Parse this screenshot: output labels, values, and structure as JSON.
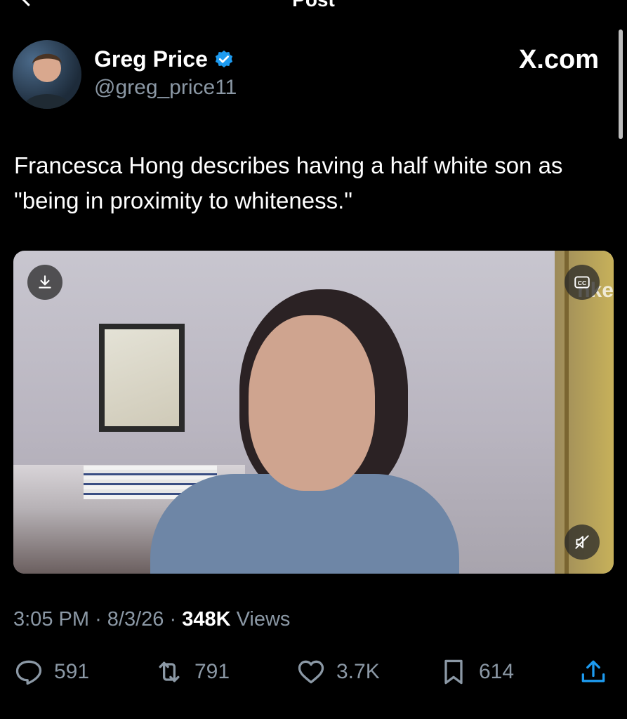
{
  "nav": {
    "title": "Post",
    "back_icon": "back-arrow-icon",
    "more_icon": "ellipsis-icon"
  },
  "author": {
    "name": "Greg Price",
    "handle": "@greg_price11",
    "verified": true,
    "verified_color": "#1d9bf0"
  },
  "site_label": "X.com",
  "post": {
    "text": "Francesca Hong describes having a half white son as \"being in proximity to whiteness.\""
  },
  "video": {
    "watermark": "nke"
  },
  "meta": {
    "time": "3:05 PM",
    "date": "8/3/26",
    "views_count": "348K",
    "views_label": "Views"
  },
  "actions": {
    "replies": "591",
    "reposts": "791",
    "likes": "3.7K",
    "bookmarks": "614"
  },
  "colors": {
    "background": "#000000",
    "secondary_text": "#8b98a5",
    "text": "#ffffff"
  }
}
